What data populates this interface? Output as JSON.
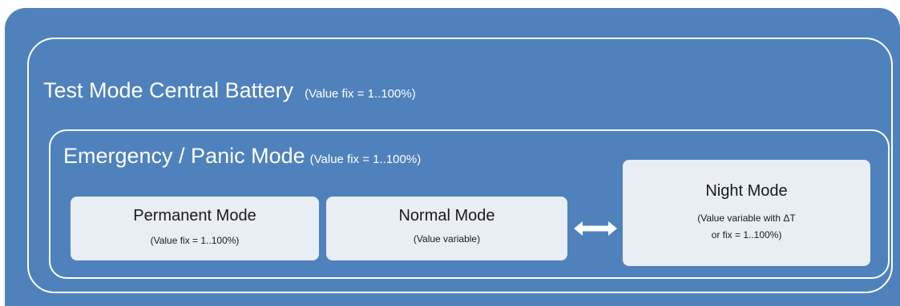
{
  "outer_mode": {
    "title": "Test Mode Central Battery",
    "value": "(Value fix = 1..100%)"
  },
  "inner_mode": {
    "title": "Emergency / Panic Mode",
    "value": "(Value fix = 1..100%)"
  },
  "modes": [
    {
      "name": "Permanent Mode",
      "desc_lines": [
        "(Value fix  = 1..100%)"
      ]
    },
    {
      "name": "Normal Mode",
      "desc_lines": [
        "(Value variable)"
      ]
    },
    {
      "name": "Night Mode",
      "desc_lines": [
        "(Value variable with ΔT",
        "or fix  = 1..100%)"
      ]
    }
  ],
  "connector": {
    "from": "Normal Mode",
    "to": "Night Mode",
    "type": "double-arrow-icon"
  },
  "colors": {
    "background": "#4f81bd",
    "frame": "#ffffff",
    "box_fill": "#e9edf4",
    "text_dark": "#1a1a1a"
  }
}
